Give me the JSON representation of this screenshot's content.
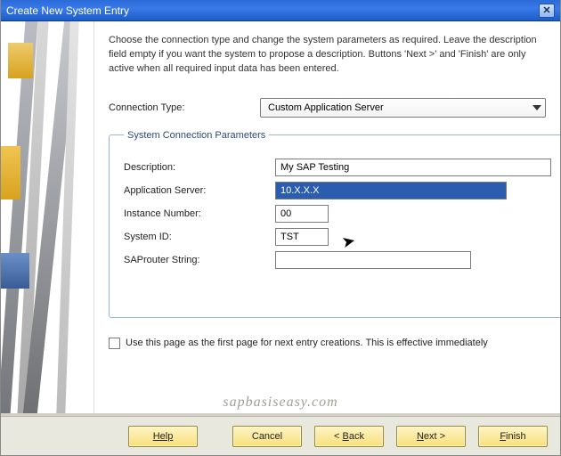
{
  "window": {
    "title": "Create New System Entry"
  },
  "instructions": "Choose the connection type and change the system parameters as required. Leave the description field empty if you want the system to propose a description. Buttons 'Next >' and 'Finish' are only active when all required input data has been entered.",
  "labels": {
    "connection_type": "Connection Type:",
    "group_title": "System Connection Parameters",
    "description": "Description:",
    "app_server": "Application Server:",
    "instance": "Instance Number:",
    "system_id": "System ID:",
    "saprouter": "SAProuter String:",
    "use_first_page": "Use this page as the first page for next entry creations. This is effective immediately"
  },
  "values": {
    "connection_type": "Custom Application Server",
    "description": "My SAP Testing",
    "app_server": "10.X.X.X",
    "instance": "00",
    "system_id": "TST",
    "saprouter": ""
  },
  "buttons": {
    "help": "Help",
    "cancel": "Cancel",
    "back": "< Back",
    "next": "Next >",
    "finish": "Finish"
  },
  "watermark": "sapbasiseasy.com"
}
